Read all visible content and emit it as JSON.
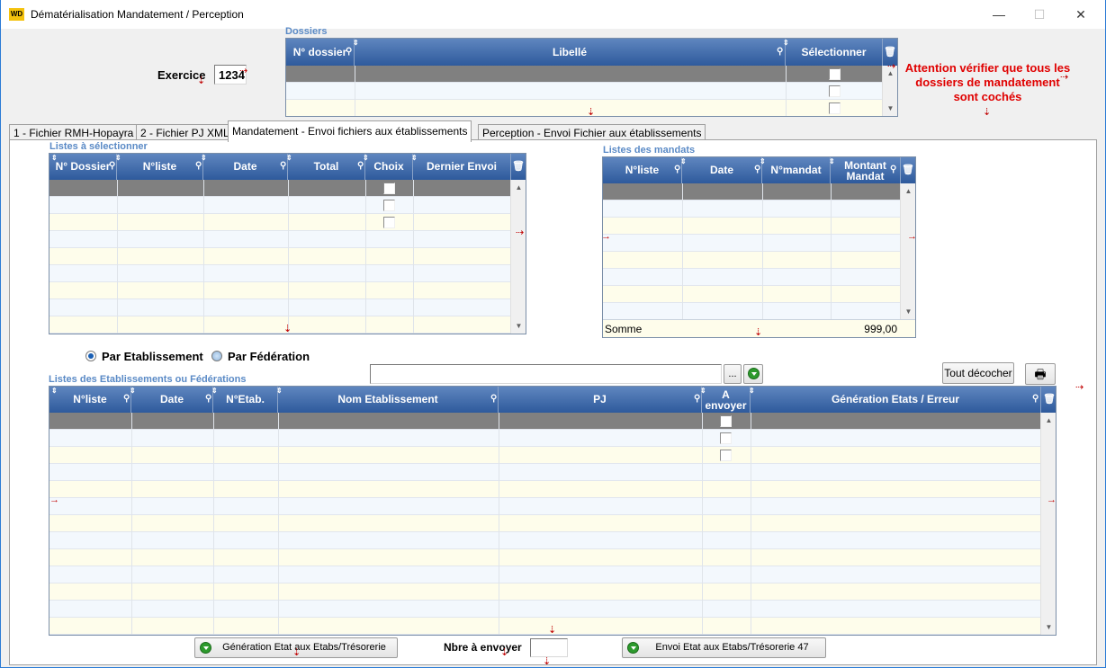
{
  "window": {
    "app_icon": "WD",
    "title": "Dématérialisation Mandatement / Perception",
    "minimize": "—",
    "maximize": "☐",
    "close": "✕"
  },
  "exercice": {
    "label": "Exercice",
    "value": "1234"
  },
  "dossiers": {
    "title": "Dossiers",
    "columns": [
      "N° dossier",
      "Libellé",
      "Sélectionner"
    ]
  },
  "warning": "Attention vérifier que tous les dossiers de mandatement sont cochés",
  "tabs": [
    "1 - Fichier RMH-Hopayra",
    "2 - Fichier PJ XML",
    "Mandatement - Envoi fichiers aux établissements",
    "Perception - Envoi Fichier aux établissements"
  ],
  "listes_selection": {
    "title": "Listes à sélectionner",
    "columns": [
      "N° Dossier",
      "N°liste",
      "Date",
      "Total",
      "Choix",
      "Dernier Envoi"
    ]
  },
  "listes_mandats": {
    "title": "Listes des mandats",
    "columns": [
      "N°liste",
      "Date",
      "N°mandat",
      "Montant Mandat"
    ],
    "footer_label": "Somme",
    "footer_value": "999,00"
  },
  "radio": {
    "option1": "Par Etablissement",
    "option2": "Par Fédération",
    "selected": "Par Etablissement"
  },
  "etablissements": {
    "title": "Listes des Etablissements ou Fédérations",
    "columns": [
      "N°liste",
      "Date",
      "N°Etab.",
      "Nom Etablissement",
      "PJ",
      "A envoyer",
      "Génération Etats / Erreur"
    ]
  },
  "buttons": {
    "browse": "...",
    "tout_decocher": "Tout décocher",
    "generation": "Génération Etat aux Etabs/Trésorerie",
    "envoi": "Envoi Etat aux Etabs/Trésorerie 47"
  },
  "nbre_envoyer": {
    "label": "Nbre à envoyer",
    "value": ""
  },
  "icons": {
    "search": "magnifier-icon",
    "sort": "sort-arrows-icon",
    "delete_column": "trash-icon",
    "print": "printer-icon",
    "anchor": "anchor-arrow-icon",
    "go": "green-go-icon"
  }
}
